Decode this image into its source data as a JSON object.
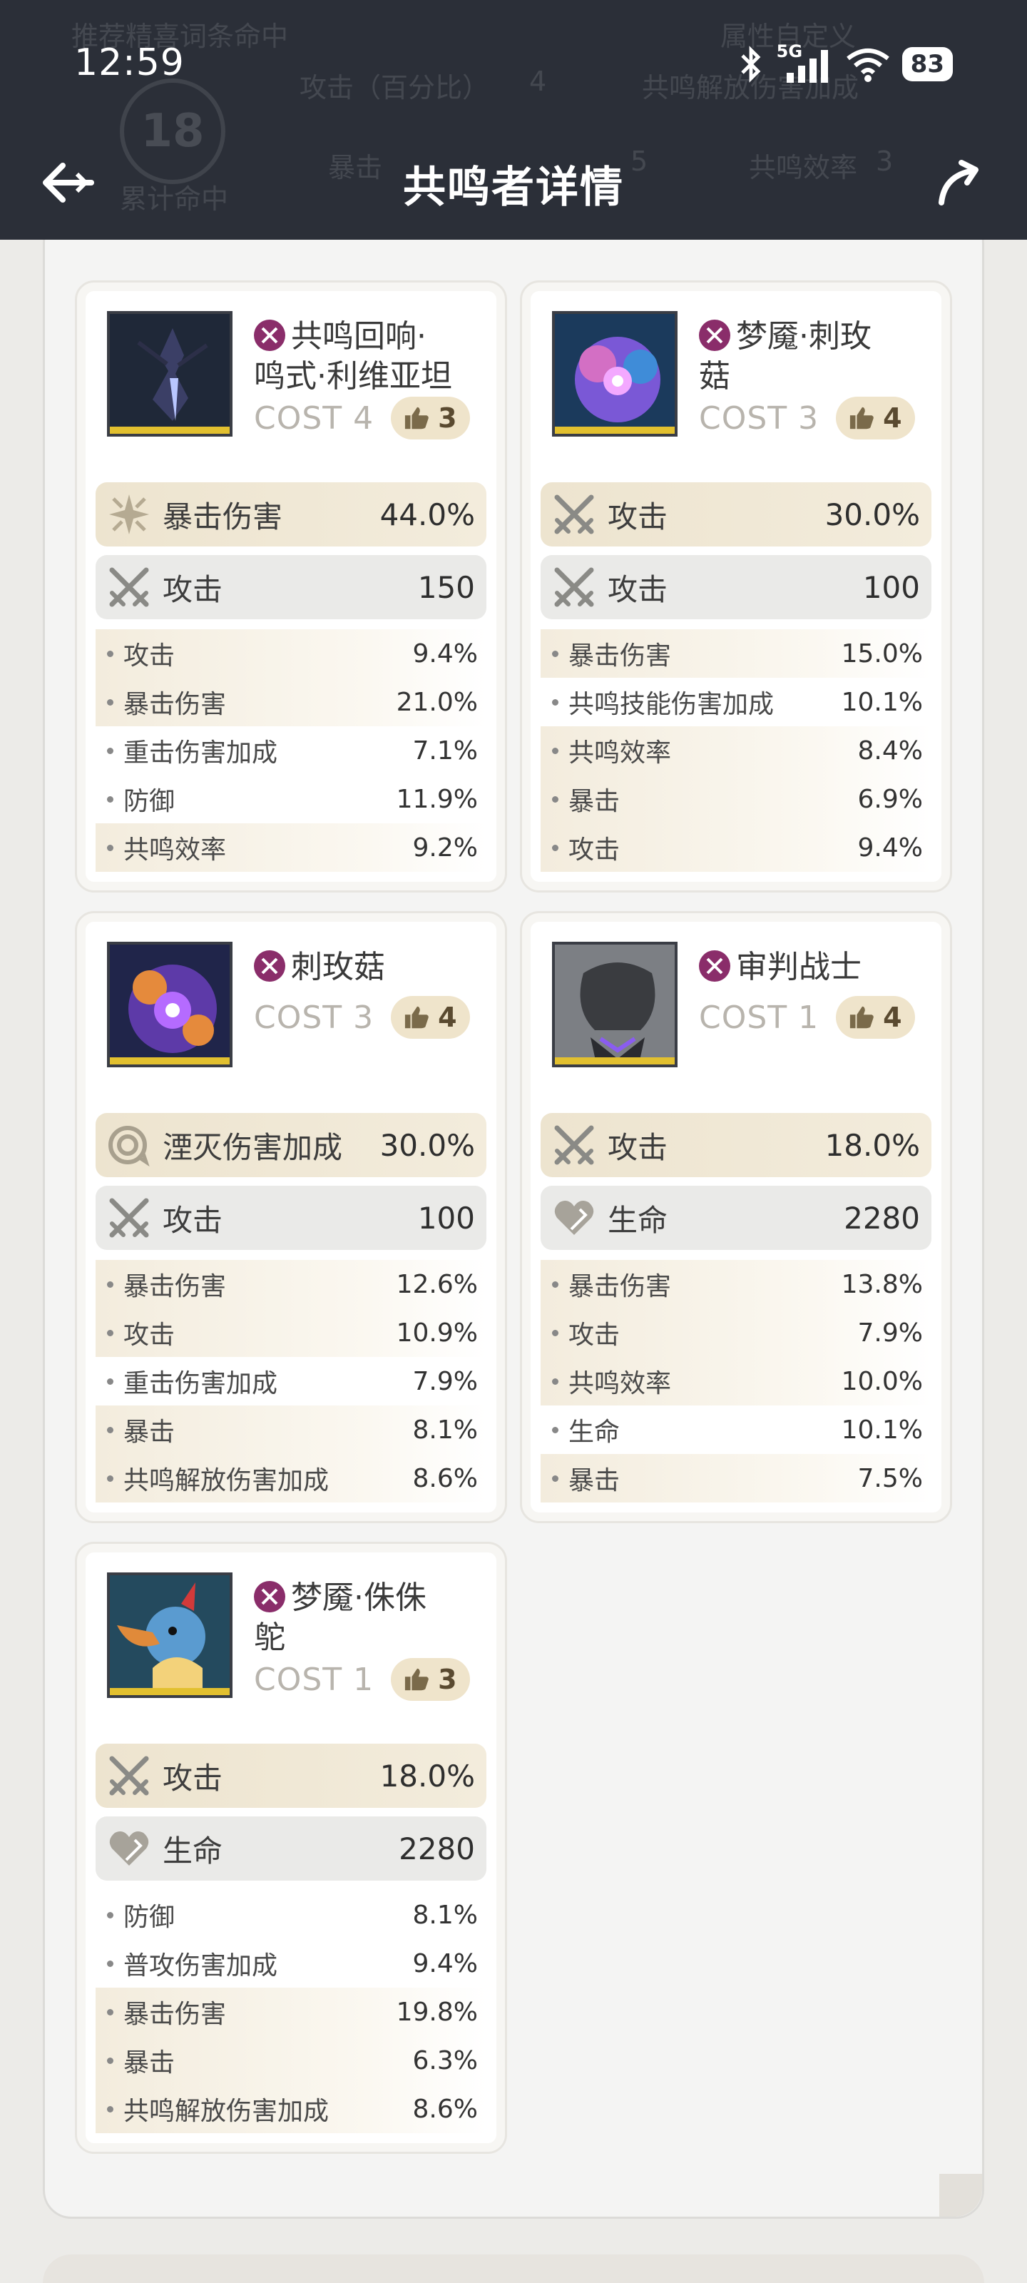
{
  "status_bar": {
    "time": "12:59",
    "network": "5G",
    "battery": "83"
  },
  "header": {
    "title": "共鸣者详情",
    "ghost_texts": [
      "推荐精喜词条命中",
      "属性自定义",
      "攻击（百分比）",
      "4",
      "共鸣解放伤害加成",
      "累计命中",
      "暴击",
      "5",
      "共鸣效率",
      "3",
      "18"
    ]
  },
  "cards": [
    {
      "name_lines": [
        "共鸣回响·",
        "鸣式·利维亚坦"
      ],
      "cost": "COST 4",
      "likes": "3",
      "main": [
        {
          "label": "暴击伤害",
          "value": "44.0%",
          "icon": "crit-damage-icon"
        },
        {
          "label": "攻击",
          "value": "150",
          "icon": "attack-icon"
        }
      ],
      "subs": [
        {
          "label": "攻击",
          "value": "9.4%",
          "hl": true
        },
        {
          "label": "暴击伤害",
          "value": "21.0%",
          "hl": true
        },
        {
          "label": "重击伤害加成",
          "value": "7.1%",
          "hl": false
        },
        {
          "label": "防御",
          "value": "11.9%",
          "hl": false
        },
        {
          "label": "共鸣效率",
          "value": "9.2%",
          "hl": true
        }
      ]
    },
    {
      "name_lines": [
        "梦魇·刺玫",
        "菇"
      ],
      "cost": "COST 3",
      "likes": "4",
      "main": [
        {
          "label": "攻击",
          "value": "30.0%",
          "icon": "attack-icon"
        },
        {
          "label": "攻击",
          "value": "100",
          "icon": "attack-icon"
        }
      ],
      "subs": [
        {
          "label": "暴击伤害",
          "value": "15.0%",
          "hl": true
        },
        {
          "label": "共鸣技能伤害加成",
          "value": "10.1%",
          "hl": false
        },
        {
          "label": "共鸣效率",
          "value": "8.4%",
          "hl": true
        },
        {
          "label": "暴击",
          "value": "6.9%",
          "hl": true
        },
        {
          "label": "攻击",
          "value": "9.4%",
          "hl": true
        }
      ]
    },
    {
      "name_lines": [
        "刺玫菇"
      ],
      "cost": "COST 3",
      "likes": "4",
      "main": [
        {
          "label": "湮灭伤害加成",
          "value": "30.0%",
          "icon": "havoc-damage-icon"
        },
        {
          "label": "攻击",
          "value": "100",
          "icon": "attack-icon"
        }
      ],
      "subs": [
        {
          "label": "暴击伤害",
          "value": "12.6%",
          "hl": true
        },
        {
          "label": "攻击",
          "value": "10.9%",
          "hl": true
        },
        {
          "label": "重击伤害加成",
          "value": "7.9%",
          "hl": false
        },
        {
          "label": "暴击",
          "value": "8.1%",
          "hl": true
        },
        {
          "label": "共鸣解放伤害加成",
          "value": "8.6%",
          "hl": true
        }
      ]
    },
    {
      "name_lines": [
        "审判战士"
      ],
      "cost": "COST 1",
      "likes": "4",
      "main": [
        {
          "label": "攻击",
          "value": "18.0%",
          "icon": "attack-icon"
        },
        {
          "label": "生命",
          "value": "2280",
          "icon": "hp-icon"
        }
      ],
      "subs": [
        {
          "label": "暴击伤害",
          "value": "13.8%",
          "hl": true
        },
        {
          "label": "攻击",
          "value": "7.9%",
          "hl": true
        },
        {
          "label": "共鸣效率",
          "value": "10.0%",
          "hl": true
        },
        {
          "label": "生命",
          "value": "10.1%",
          "hl": false
        },
        {
          "label": "暴击",
          "value": "7.5%",
          "hl": true
        }
      ]
    },
    {
      "name_lines": [
        "梦魇·侏侏",
        "鸵"
      ],
      "cost": "COST 1",
      "likes": "3",
      "main": [
        {
          "label": "攻击",
          "value": "18.0%",
          "icon": "attack-icon"
        },
        {
          "label": "生命",
          "value": "2280",
          "icon": "hp-icon"
        }
      ],
      "subs": [
        {
          "label": "防御",
          "value": "8.1%",
          "hl": false
        },
        {
          "label": "普攻伤害加成",
          "value": "9.4%",
          "hl": false
        },
        {
          "label": "暴击伤害",
          "value": "19.8%",
          "hl": true
        },
        {
          "label": "暴击",
          "value": "6.3%",
          "hl": true
        },
        {
          "label": "共鸣解放伤害加成",
          "value": "8.6%",
          "hl": true
        }
      ]
    }
  ]
}
